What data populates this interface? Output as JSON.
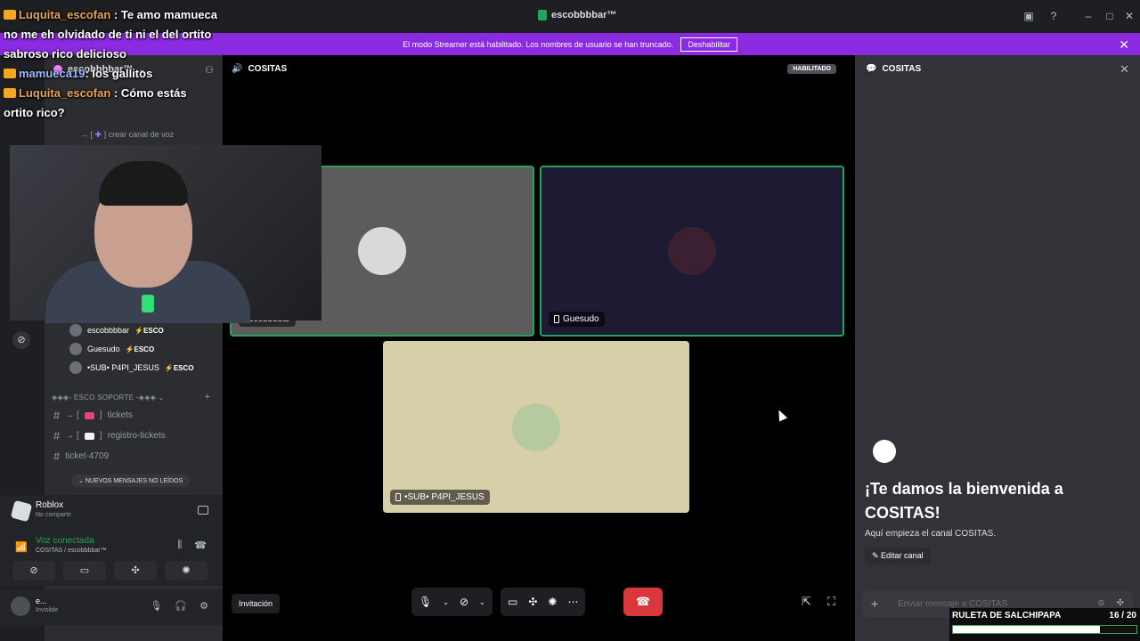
{
  "titlebar": {
    "title": "escobbbbar™"
  },
  "streamer_bar": {
    "message": "El modo Streamer está habilitado. Los nombres de usuario se han truncado.",
    "disable_label": "Deshabilitar"
  },
  "sidebar": {
    "server_name": "escobbbbar™",
    "create_voice": "crear canal de voz",
    "voice_users": [
      {
        "name": "escobbbbar",
        "tag": "ESCO"
      },
      {
        "name": "Guesudo",
        "tag": "ESCO"
      },
      {
        "name": "•SUB• P4PI_JESUS",
        "tag": "ESCO"
      }
    ],
    "category": "◈◈◈- ESCO SOPORTE -◈◈◈",
    "channels": [
      {
        "name": "tickets"
      },
      {
        "name": "registro-tickets"
      },
      {
        "name": "ticket-4709"
      }
    ],
    "unread_pill": "NUEVOS MENSAJES NO LEÍDOS"
  },
  "activity": {
    "title": "Roblox",
    "subtitle": "No compartir"
  },
  "voice_panel": {
    "status": "Voz conectada",
    "channel": "COSITAS / escobbbbar™"
  },
  "user_panel": {
    "name": "e...",
    "status": "Invisible"
  },
  "stage": {
    "channel": "COSITAS",
    "habilitado": "HABILITADO",
    "tiles": [
      {
        "name": "escobbbbar"
      },
      {
        "name": "Guesudo"
      },
      {
        "name": "•SUB• P4PI_JESUS"
      }
    ],
    "invite_label": "Invitación"
  },
  "chat": {
    "channel": "COSITAS",
    "welcome": "¡Te damos la bienvenida a COSITAS!",
    "subtitle": "Aquí empieza el canal COSITAS.",
    "edit_label": "Editar canal",
    "input_placeholder": "Enviar mensaje a COSITAS"
  },
  "overlay_chat": [
    {
      "user": "Luquita_escofan",
      "text": "Te amo mamueca no me eh olvidado de ti ni el del ortito sabroso rico delicioso"
    },
    {
      "user": "mamueca19",
      "text": "los gallitos"
    },
    {
      "user": "Luquita_escofan",
      "text": "Cómo estás ortito rico?"
    }
  ],
  "ruleta": {
    "title": "RULETA DE SALCHIPAPA",
    "current": 16,
    "total": 20,
    "count_label": "16 / 20"
  },
  "colors": {
    "accent": "#8a2be2",
    "green": "#23a55a",
    "hangup": "#da373c",
    "tile1": "#5c5c5c",
    "tile2": "#1e1a33",
    "tile3": "#d6cfa8"
  }
}
